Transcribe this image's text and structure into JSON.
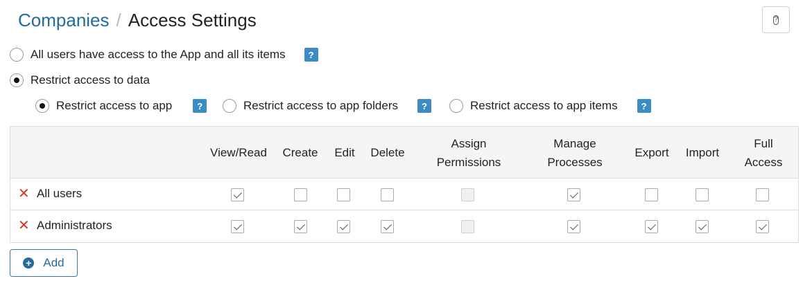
{
  "breadcrumb": {
    "parent": "Companies",
    "separator": "/",
    "current": "Access Settings"
  },
  "help_button": {
    "icon": "help-icon",
    "glyph": "?"
  },
  "access_mode": {
    "options": [
      {
        "label": "All users have access to the App and all its items",
        "selected": false,
        "help": "?"
      },
      {
        "label": "Restrict access to data",
        "selected": true
      }
    ]
  },
  "restrict_scope": {
    "options": [
      {
        "label": "Restrict access to app",
        "selected": true,
        "help": "?"
      },
      {
        "label": "Restrict access to app folders",
        "selected": false,
        "help": "?"
      },
      {
        "label": "Restrict access to app items",
        "selected": false,
        "help": "?"
      }
    ]
  },
  "permissions_table": {
    "columns": [
      "View/Read",
      "Create",
      "Edit",
      "Delete",
      "Assign\nPermissions",
      "Manage\nProcesses",
      "Export",
      "Import",
      "Full\nAccess"
    ],
    "rows": [
      {
        "name": "All users",
        "remove_icon": "close-icon",
        "values": [
          true,
          false,
          false,
          false,
          null,
          true,
          false,
          false,
          false
        ]
      },
      {
        "name": "Administrators",
        "remove_icon": "close-icon",
        "values": [
          true,
          true,
          true,
          true,
          null,
          true,
          true,
          true,
          true
        ]
      }
    ]
  },
  "add_button": {
    "label": "Add",
    "icon": "plus-circle-icon"
  },
  "colors": {
    "link": "#236c9c",
    "help_badge": "#3b8cc3",
    "remove": "#d9322b",
    "header_bg": "#f5f5f5"
  }
}
